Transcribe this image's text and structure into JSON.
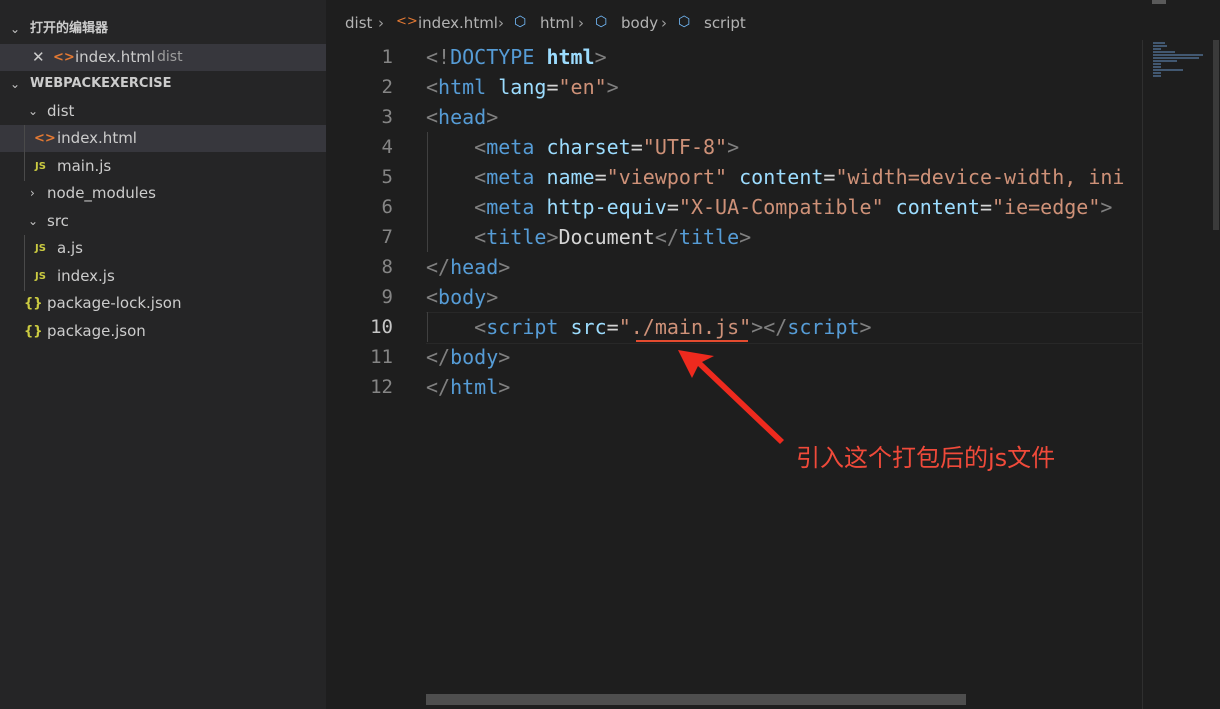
{
  "sidebar": {
    "open_editors_title": "打开的编辑器",
    "open_editor_file": "index.html",
    "open_editor_dir": "dist",
    "project_title": "WEBPACKEXERCISE",
    "items": [
      {
        "label": "dist",
        "kind": "folder",
        "expanded": true
      },
      {
        "label": "index.html",
        "kind": "html",
        "selected": true
      },
      {
        "label": "main.js",
        "kind": "js"
      },
      {
        "label": "node_modules",
        "kind": "folder",
        "expanded": false
      },
      {
        "label": "src",
        "kind": "folder",
        "expanded": true
      },
      {
        "label": "a.js",
        "kind": "js"
      },
      {
        "label": "index.js",
        "kind": "js"
      },
      {
        "label": "package-lock.json",
        "kind": "json"
      },
      {
        "label": "package.json",
        "kind": "json"
      }
    ]
  },
  "breadcrumb": {
    "seg1": "dist",
    "seg2": "index.html",
    "seg3": "html",
    "seg4": "body",
    "seg5": "script"
  },
  "editor": {
    "line_numbers": [
      "1",
      "2",
      "3",
      "4",
      "5",
      "6",
      "7",
      "8",
      "9",
      "10",
      "11",
      "12"
    ],
    "active_line": "10",
    "code": {
      "l1": {
        "open": "<!",
        "doctype": "DOCTYPE",
        "html": "html",
        "close": ">"
      },
      "l2": {
        "tag": "html",
        "attr": "lang",
        "val": "\"en\""
      },
      "l3": {
        "tag": "head"
      },
      "l4": {
        "tag": "meta",
        "attr": "charset",
        "val": "\"UTF-8\""
      },
      "l5": {
        "tag": "meta",
        "attr1": "name",
        "val1": "\"viewport\"",
        "attr2": "content",
        "val2": "\"width=device-width, ini"
      },
      "l6": {
        "tag": "meta",
        "attr1": "http-equiv",
        "val1": "\"X-UA-Compatible\"",
        "attr2": "content",
        "val2": "\"ie=edge\""
      },
      "l7": {
        "tag": "title",
        "text": "Document"
      },
      "l8": {
        "tag": "head"
      },
      "l9": {
        "tag": "body"
      },
      "l10": {
        "tag": "script",
        "attr": "src",
        "val_q": "\"",
        "val": "./main.js",
        "val_q2": "\""
      },
      "l11": {
        "tag": "body"
      },
      "l12": {
        "tag": "html"
      }
    }
  },
  "annotation": {
    "text": "引入这个打包后的js文件",
    "color": "#f04a3a"
  },
  "icons": {
    "html": "html-file-icon",
    "js": "js-file-icon",
    "json": "json-file-icon",
    "symbol": "symbol-cube-icon"
  },
  "colors": {
    "tag": "#569cd6",
    "attr": "#9cdcfe",
    "string": "#ce9178",
    "punct": "#808080"
  }
}
